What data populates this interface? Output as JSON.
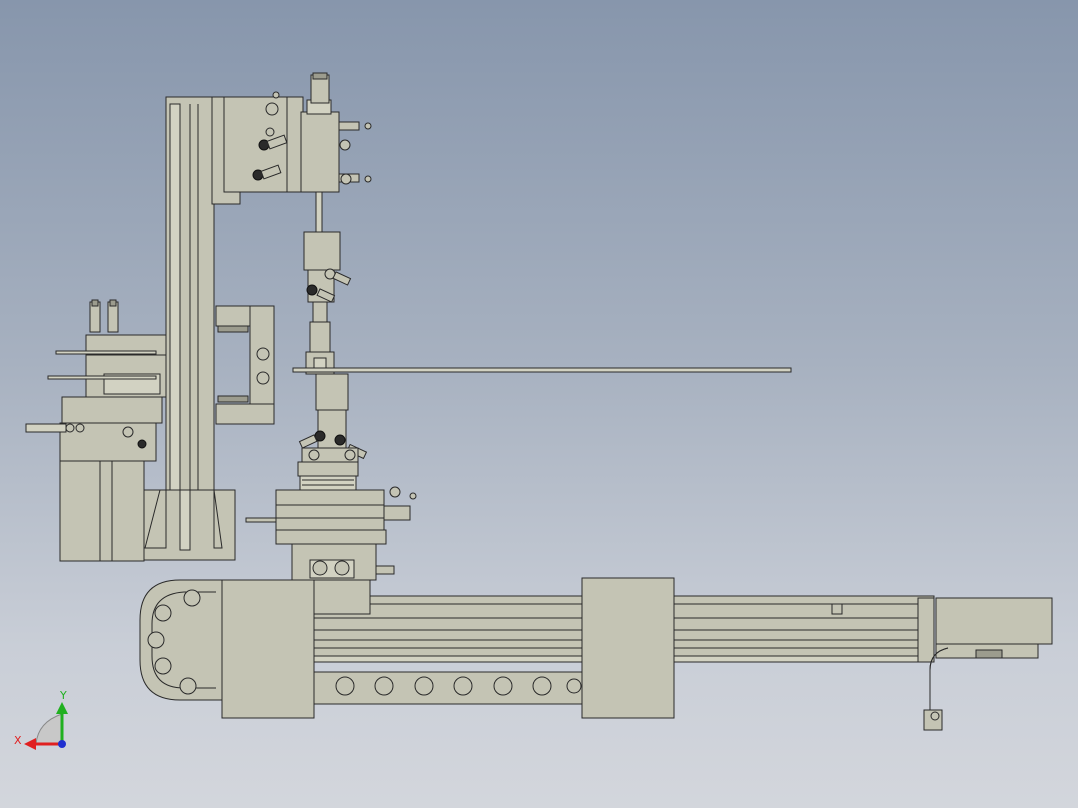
{
  "view": {
    "background_top": "#8796ac",
    "background_bottom": "#d3d6dc",
    "part_color": "#c4c4b4",
    "edge_color": "#2a2a2a"
  },
  "triad": {
    "x_label": "X",
    "y_label": "Y",
    "x_color": "#e02020",
    "y_color": "#20b020",
    "z_color": "#2030d0"
  }
}
